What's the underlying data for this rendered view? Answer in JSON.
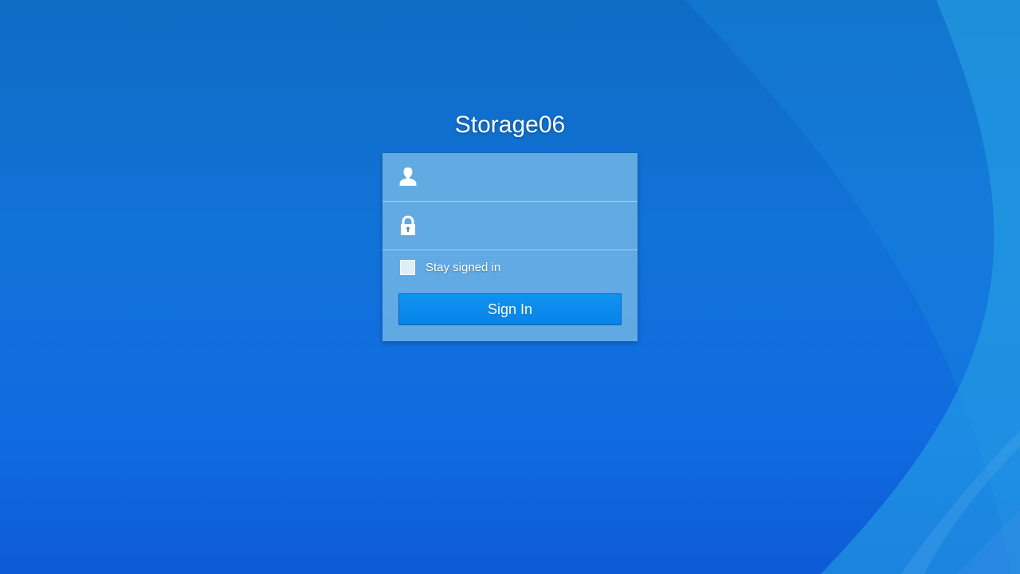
{
  "title": "Storage06",
  "login": {
    "username_placeholder": "",
    "username_value": "",
    "password_placeholder": "",
    "password_value": "",
    "stay_signed_in_label": "Stay signed in",
    "stay_signed_in_checked": false,
    "sign_in_label": "Sign In"
  },
  "icons": {
    "username": "user-icon",
    "password": "lock-icon"
  },
  "colors": {
    "background": "#1172d8",
    "panel": "#6cb2e4",
    "button": "#0683e8",
    "text": "#ffffff"
  }
}
